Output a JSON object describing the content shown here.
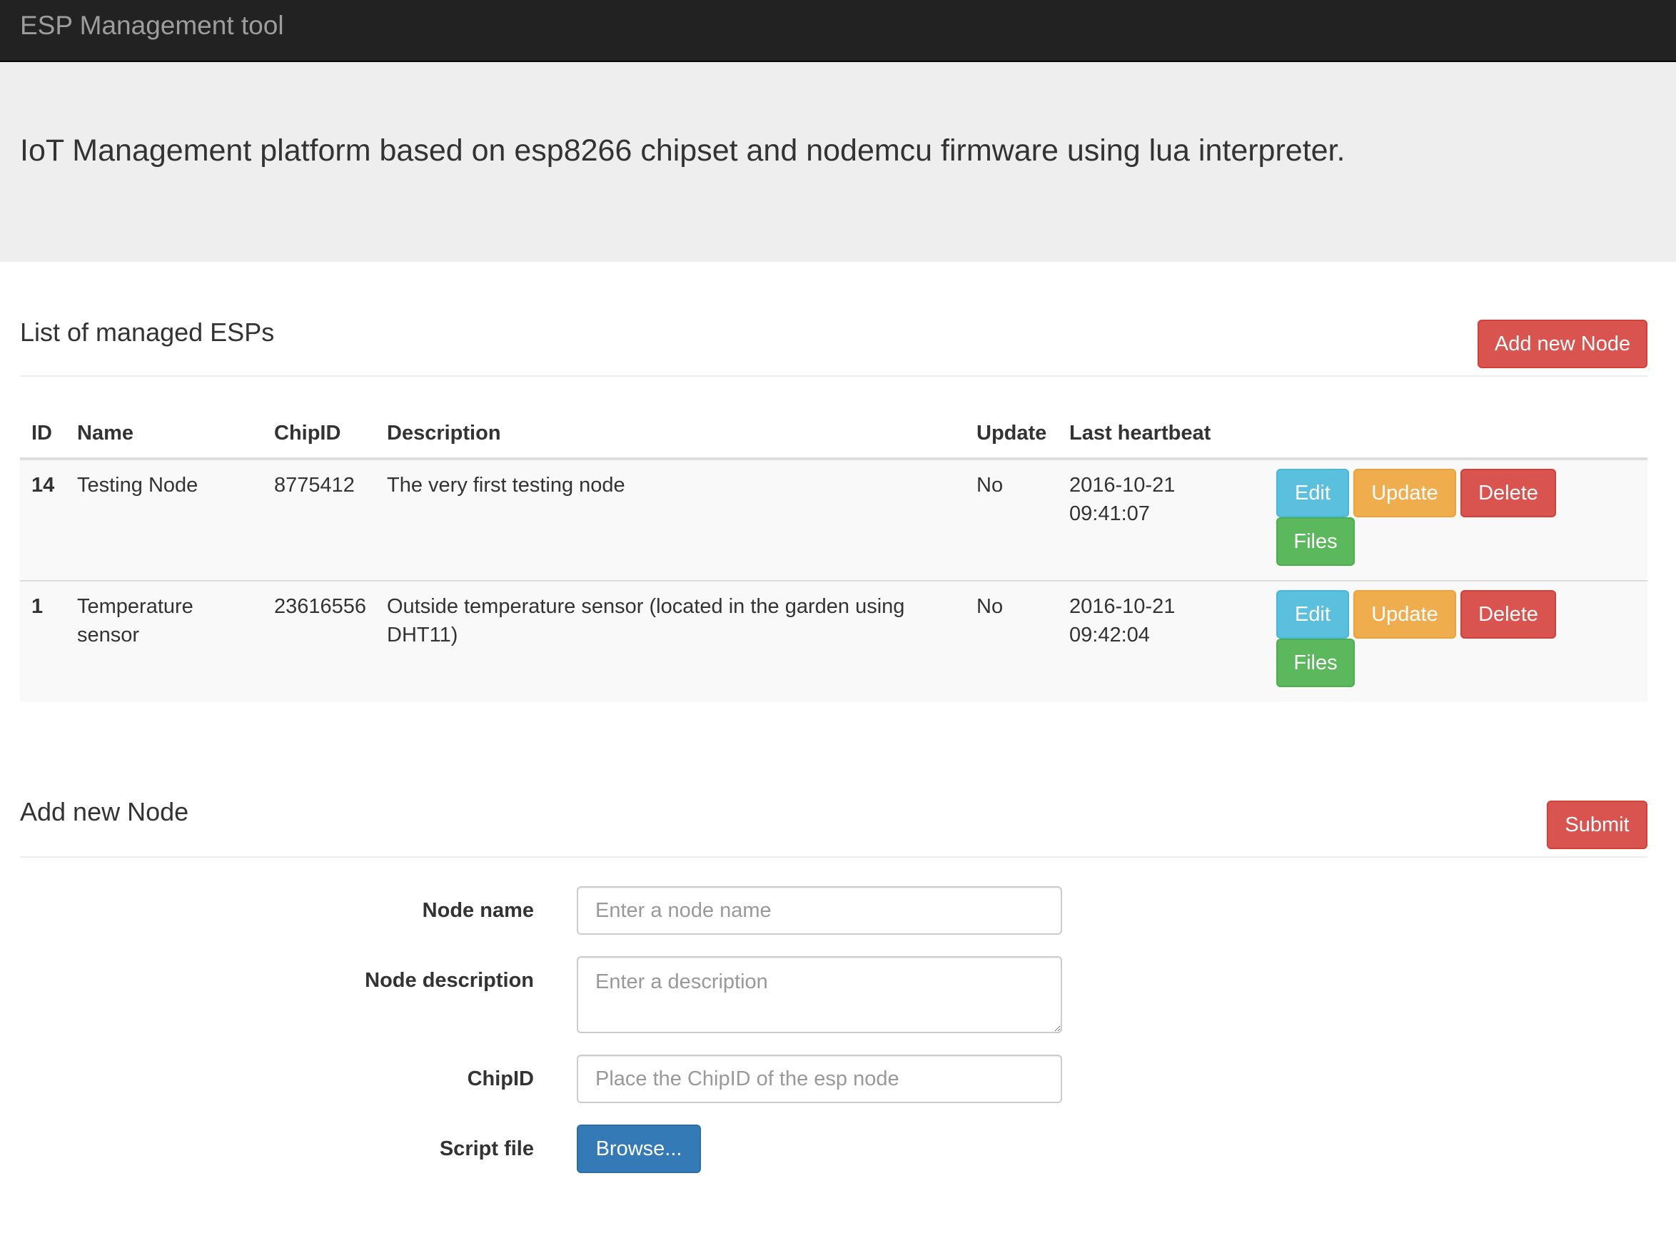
{
  "navbar": {
    "brand": "ESP Management tool"
  },
  "jumbotron": {
    "lead": "IoT Management platform based on esp8266 chipset and nodemcu firmware using lua interpreter."
  },
  "list_section": {
    "title": "List of managed ESPs",
    "add_button": "Add new Node"
  },
  "table": {
    "headers": [
      "ID",
      "Name",
      "ChipID",
      "Description",
      "Update",
      "Last heartbeat"
    ],
    "rows": [
      {
        "id": "14",
        "name": "Testing Node",
        "chipid": "8775412",
        "description": "The very first testing node",
        "update": "No",
        "heartbeat_date": "2016-10-21",
        "heartbeat_time": "09:41:07"
      },
      {
        "id": "1",
        "name": "Temperature sensor",
        "chipid": "23616556",
        "description": "Outside temperature sensor (located in the garden using DHT11)",
        "update": "No",
        "heartbeat_date": "2016-10-21",
        "heartbeat_time": "09:42:04"
      }
    ],
    "actions": {
      "edit": "Edit",
      "update": "Update",
      "delete": "Delete",
      "files": "Files"
    }
  },
  "add_section": {
    "title": "Add new Node",
    "submit_button": "Submit"
  },
  "form": {
    "node_name": {
      "label": "Node name",
      "placeholder": "Enter a node name",
      "value": ""
    },
    "node_description": {
      "label": "Node description",
      "placeholder": "Enter a description",
      "value": ""
    },
    "chipid": {
      "label": "ChipID",
      "placeholder": "Place the ChipID of the esp node",
      "value": ""
    },
    "script_file": {
      "label": "Script file",
      "button": "Browse..."
    }
  },
  "colors": {
    "navbar_bg": "#222222",
    "jumbotron_bg": "#eeeeee",
    "danger": "#d9534f",
    "info": "#5bc0de",
    "warning": "#f0ad4e",
    "success": "#5cb85c",
    "primary": "#337ab7"
  }
}
